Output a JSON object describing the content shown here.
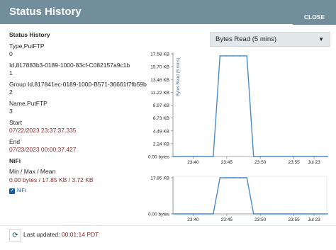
{
  "dialog": {
    "title": "Status History"
  },
  "details": {
    "heading": "Status History",
    "rows": [
      {
        "label": "Type,PutFTP",
        "value": "0"
      },
      {
        "label": "Id,817883b3-0189-1000-83cf-C082157a9c1b",
        "value": "1"
      },
      {
        "label": "Group Id,817841ec-0189-1000-B571-36661f7fb59b",
        "value": "2"
      },
      {
        "label": "Name,PutFTP",
        "value": "3"
      },
      {
        "label": "Start",
        "value": "07/22/2023 23:37:37.335"
      },
      {
        "label": "End",
        "value": "07/23/2023 00:00:37.427"
      }
    ],
    "nifi_heading": "NiFi",
    "stats_label": "Min / Max / Mean",
    "stats_value": "0.00 bytes / 17.85 KB / 3.72 KB",
    "legend_label": "NiFi",
    "legend_check": "✓"
  },
  "metric_select": {
    "value": "Bytes Read (5 mins)",
    "caret": "▼"
  },
  "footer": {
    "refresh_icon": "⟳",
    "last_updated_label": "Last updated:",
    "last_updated_time": "00:01:14 PDT",
    "close_label": "CLOSE"
  },
  "colors": {
    "header": "#728e9b",
    "series": "#4a8bc6",
    "value_red": "#8a2a2a"
  },
  "chart_data": [
    {
      "type": "line",
      "ylabel": "Bytes Read (5 mins)",
      "y_ticks": [
        "0.00 bytes",
        "2.24 KB",
        "4.49 KB",
        "6.73 KB",
        "8.97 KB",
        "11.22 KB",
        "13.46 KB",
        "15.70 KB",
        "17.58 KB"
      ],
      "x_ticks": [
        "23:40",
        "23:45",
        "23:50",
        "23:55",
        "Jul 23"
      ],
      "ylim": [
        0,
        17.94
      ],
      "series": [
        {
          "x": [
            "23:37",
            "23:40",
            "23:43",
            "23:44",
            "23:45",
            "23:46",
            "23:47",
            "23:48",
            "23:49",
            "23:50",
            "23:55",
            "23:58",
            "00:00"
          ],
          "values": [
            0,
            0,
            0,
            17.58,
            17.58,
            17.58,
            17.58,
            17.58,
            0,
            0,
            0,
            0,
            0
          ]
        }
      ]
    },
    {
      "type": "line",
      "y_ticks": [
        "0.00 bytes",
        "17.85 KB"
      ],
      "x_ticks": [
        "23:40",
        "23:45",
        "23:50",
        "23:55",
        "Jul 23"
      ],
      "ylim": [
        0,
        17.85
      ],
      "series": [
        {
          "x": [
            "23:37",
            "23:40",
            "23:43",
            "23:44",
            "23:45",
            "23:46",
            "23:47",
            "23:48",
            "23:49",
            "23:50",
            "23:55",
            "23:58",
            "00:00"
          ],
          "values": [
            0,
            0,
            0,
            17.85,
            17.85,
            17.85,
            17.85,
            17.85,
            0,
            0,
            0,
            0,
            0
          ]
        }
      ]
    }
  ]
}
